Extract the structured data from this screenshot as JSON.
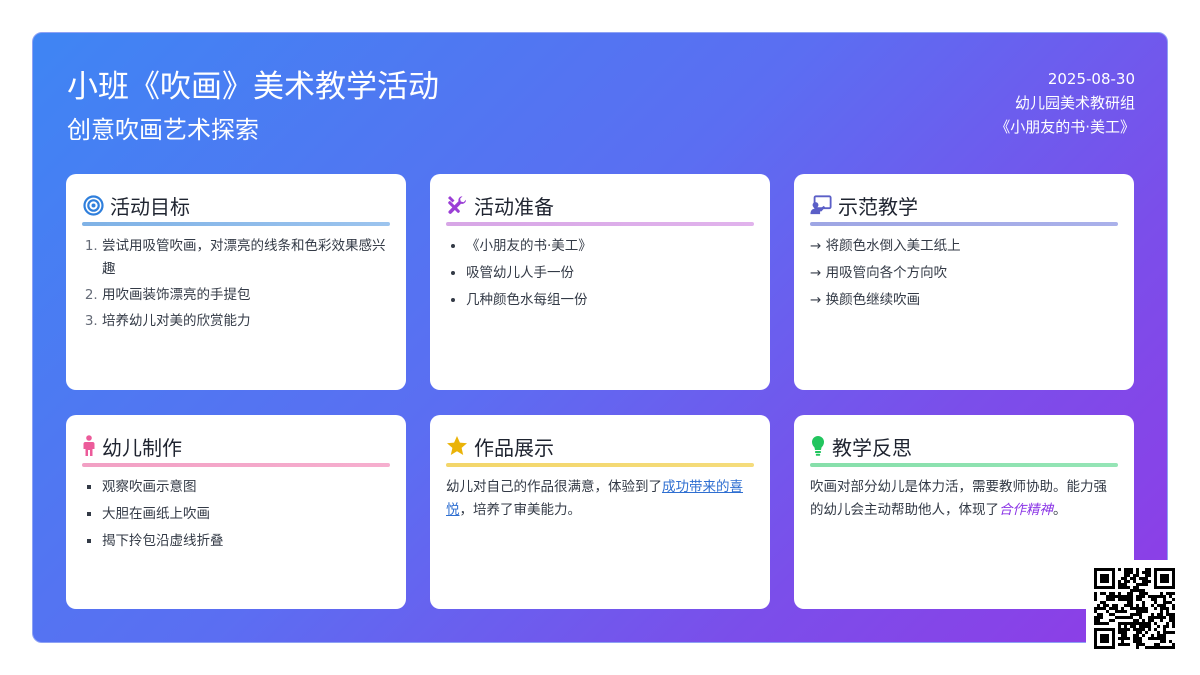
{
  "header": {
    "title": "小班《吹画》美术教学活动",
    "subtitle": "创意吹画艺术探索",
    "date": "2025-08-30",
    "organization": "幼儿园美术教研组",
    "source": "《小朋友的书·美工》"
  },
  "colors": {
    "goal_accent": "#2f7fdc",
    "prep_accent": "#9b3fd6",
    "demo_accent": "#5b5fc7",
    "kids_accent": "#ec5b9a",
    "show_accent": "#eab308",
    "reflect_accent": "#22c55e"
  },
  "cards": {
    "goal": {
      "icon": "target-icon",
      "title": "活动目标",
      "items": [
        "尝试用吸管吹画，对漂亮的线条和色彩效果感兴趣",
        "用吹画装饰漂亮的手提包",
        "培养幼儿对美的欣赏能力"
      ]
    },
    "prep": {
      "icon": "tools-icon",
      "title": "活动准备",
      "items": [
        "《小朋友的书·美工》",
        "吸管幼儿人手一份",
        "几种颜色水每组一份"
      ]
    },
    "demo": {
      "icon": "teacher-icon",
      "title": "示范教学",
      "items": [
        "→ 将颜色水倒入美工纸上",
        "→ 用吸管向各个方向吹",
        "→ 换颜色继续吹画"
      ]
    },
    "kids": {
      "icon": "child-icon",
      "title": "幼儿制作",
      "items": [
        "观察吹画示意图",
        "大胆在画纸上吹画",
        "揭下拎包沿虚线折叠"
      ]
    },
    "show": {
      "icon": "star-icon",
      "title": "作品展示",
      "text_before": "幼儿对自己的作品很满意，体验到了",
      "text_link": "成功带来的喜悦",
      "text_after": "，培养了审美能力。"
    },
    "reflect": {
      "icon": "lightbulb-icon",
      "title": "教学反思",
      "text_before": "吹画对部分幼儿是体力活，需要教师协助。能力强的幼儿会主动帮助他人，体现了",
      "text_em": "合作精神",
      "text_after": "。"
    }
  }
}
